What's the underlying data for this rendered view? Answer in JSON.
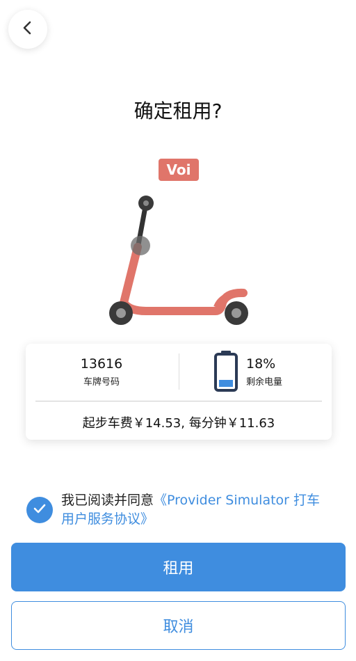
{
  "header": {
    "back_icon": "chevron-left-icon"
  },
  "title": "确定租用?",
  "vehicle": {
    "brand": "Voi",
    "brand_color": "#e0756a",
    "image_icon": "kick-scooter-illustration"
  },
  "card": {
    "plate_number": "13616",
    "plate_label": "车牌号码",
    "battery_percent": "18%",
    "battery_label": "剩余电量",
    "battery_level": 0.18,
    "battery_icon": "battery-icon",
    "pricing": "起步车费￥14.53, 每分钟￥11.63"
  },
  "agreement": {
    "checked": true,
    "check_icon": "checkmark-icon",
    "prefix": "我已阅读并同意",
    "link": "《Provider Simulator 打车用户服务协议》"
  },
  "actions": {
    "rent_label": "租用",
    "cancel_label": "取消"
  },
  "colors": {
    "accent": "#3f8ddf",
    "scooter": "#e0756a"
  }
}
